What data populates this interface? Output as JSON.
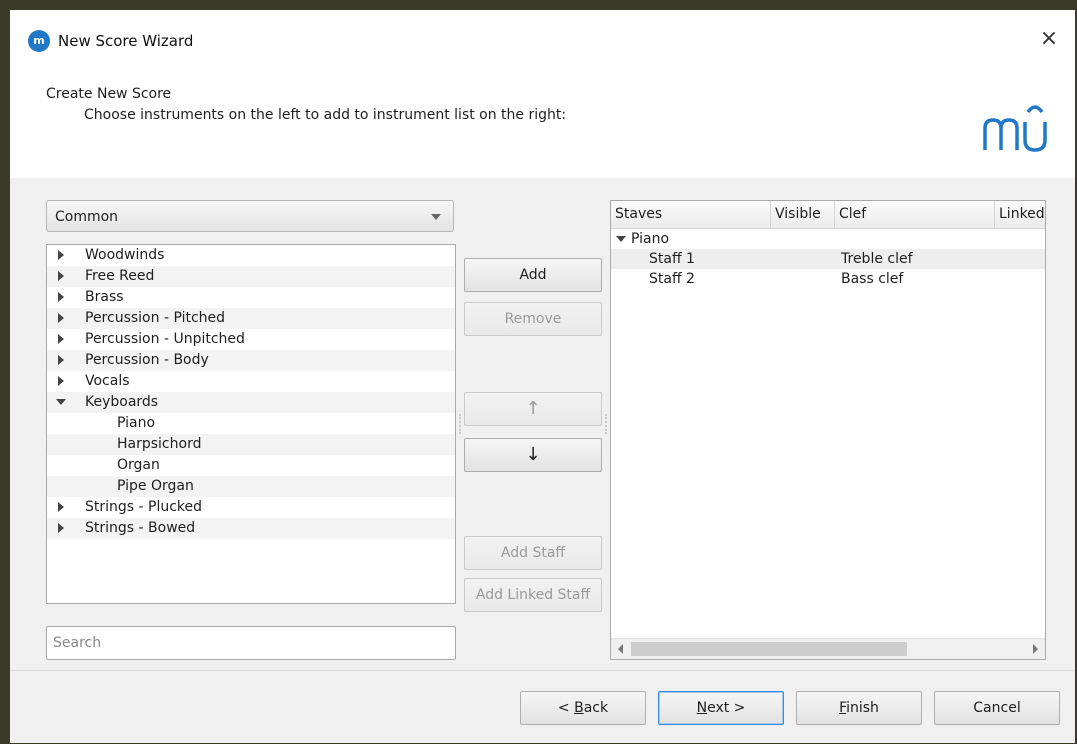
{
  "window": {
    "title": "New Score Wizard",
    "close_glyph": "×",
    "app_icon": "musescore-icon"
  },
  "header": {
    "title": "Create New Score",
    "subtitle": "Choose instruments on the left to add to instrument list on the right:",
    "logo_text": "mΰ"
  },
  "left": {
    "category": "Common",
    "groups": [
      {
        "label": "Woodwinds",
        "expanded": false
      },
      {
        "label": "Free Reed",
        "expanded": false
      },
      {
        "label": "Brass",
        "expanded": false
      },
      {
        "label": "Percussion - Pitched",
        "expanded": false
      },
      {
        "label": "Percussion - Unpitched",
        "expanded": false
      },
      {
        "label": "Percussion - Body",
        "expanded": false
      },
      {
        "label": "Vocals",
        "expanded": false
      },
      {
        "label": "Keyboards",
        "expanded": true
      },
      {
        "label": "Piano",
        "child": true
      },
      {
        "label": "Harpsichord",
        "child": true
      },
      {
        "label": "Organ",
        "child": true
      },
      {
        "label": "Pipe Organ",
        "child": true
      },
      {
        "label": "Strings - Plucked",
        "expanded": false
      },
      {
        "label": "Strings - Bowed",
        "expanded": false
      }
    ],
    "search_placeholder": "Search"
  },
  "middle": {
    "add": "Add",
    "remove": "Remove",
    "up": "↑",
    "down": "↓",
    "add_staff": "Add Staff",
    "add_linked_staff": "Add Linked Staff"
  },
  "staves": {
    "columns": [
      "Staves",
      "Visible",
      "Clef",
      "Linked"
    ],
    "instrument": "Piano",
    "rows": [
      {
        "name": "Staff 1",
        "clef": "Treble clef"
      },
      {
        "name": "Staff 2",
        "clef": "Bass clef"
      }
    ]
  },
  "footer": {
    "back_prefix": "< ",
    "back_key": "B",
    "back_rest": "ack",
    "next_key": "N",
    "next_rest": "ext >",
    "finish_key": "F",
    "finish_rest": "inish",
    "cancel": "Cancel"
  }
}
